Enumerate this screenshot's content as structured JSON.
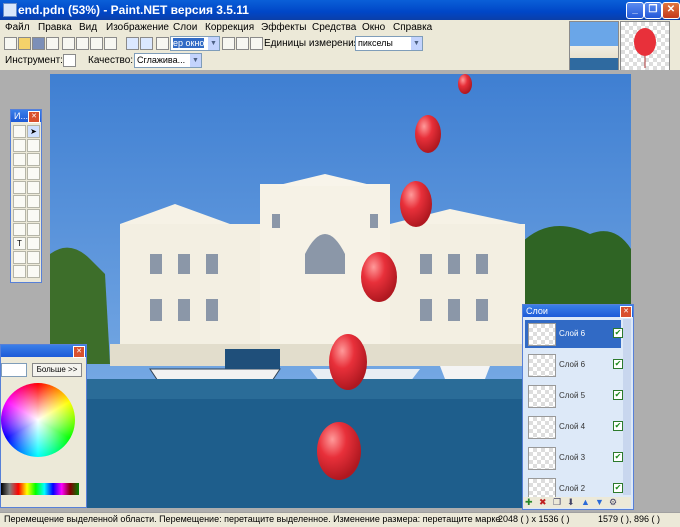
{
  "window": {
    "title": "end.pdn (53%) - Paint.NET версия 3.5.11"
  },
  "menu": [
    "Файл",
    "Правка",
    "Вид",
    "Изображение",
    "Слои",
    "Коррекция",
    "Эффекты",
    "Средства",
    "Окно",
    "Справка"
  ],
  "toolbar": {
    "zoom_value": "ер окно",
    "units_label": "Единицы измерения:",
    "units_value": "пикселы"
  },
  "toolbar2": {
    "tool_label": "Инструмент:",
    "quality_label": "Качество:",
    "quality_value": "Сглажива..."
  },
  "colors_palette": {
    "more_button": "Больше >>"
  },
  "layers_palette": {
    "title": "Слои",
    "layers": [
      {
        "name": "Слой 6"
      },
      {
        "name": "Слой 6"
      },
      {
        "name": "Слой 5"
      },
      {
        "name": "Слой 4"
      },
      {
        "name": "Слой 3"
      },
      {
        "name": "Слой 2"
      }
    ]
  },
  "tools_palette": {
    "title": "И..."
  },
  "status": {
    "hint": "Перемещение выделенной области. Перемещение: перетащите выделенное. Изменение размера: перетащите марке",
    "image_size": "2048 (  ) x 1536 (  )",
    "cursor_pos": "1579 (  ), 896 (  )"
  },
  "colors": {
    "titlebar": "#0046c7",
    "balloon": "#e8303a",
    "sky": "#5b93d8",
    "sea": "#1e5e8c"
  }
}
